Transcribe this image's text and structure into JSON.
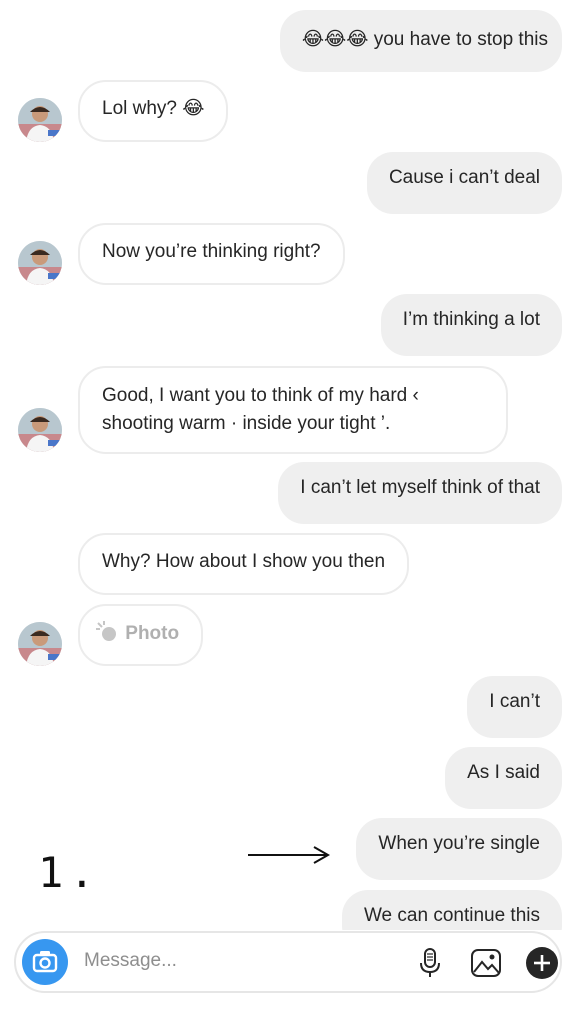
{
  "thread": {
    "messages": [
      {
        "from": "me",
        "text": "you have to stop this",
        "emoji_prefix": "😂😂😂"
      },
      {
        "from": "them",
        "text": "Lol why? ",
        "emoji_suffix": "😂"
      },
      {
        "from": "me",
        "text": "Cause i can’t deal"
      },
      {
        "from": "them",
        "text": "Now you’re thinking right?"
      },
      {
        "from": "me",
        "text": "I’m thinking a lot"
      },
      {
        "from": "them",
        "line1": "Good, I want you to think of my hard ‹ ",
        "line2": "shooting warm ·  inside your tight ’."
      },
      {
        "from": "me",
        "text": "I can’t let myself think of that"
      },
      {
        "from": "them",
        "text": "Why? How about I show you then"
      },
      {
        "from": "them",
        "text": "Photo"
      },
      {
        "from": "me",
        "text": "I can’t"
      },
      {
        "from": "me",
        "text": "As I said"
      },
      {
        "from": "me",
        "text": "When you’re single"
      },
      {
        "from": "me",
        "text": "We can continue this"
      }
    ]
  },
  "composer": {
    "placeholder": "Message..."
  },
  "annotation": {
    "label": "1."
  },
  "colors": {
    "outgoing_bubble": "#efefef",
    "incoming_border": "#ececec",
    "camera_button": "#3797f0"
  },
  "icons": [
    "camera-icon",
    "microphone-icon",
    "gallery-icon",
    "plus-icon",
    "photo-tap-icon",
    "laughing-emoji-icon"
  ]
}
